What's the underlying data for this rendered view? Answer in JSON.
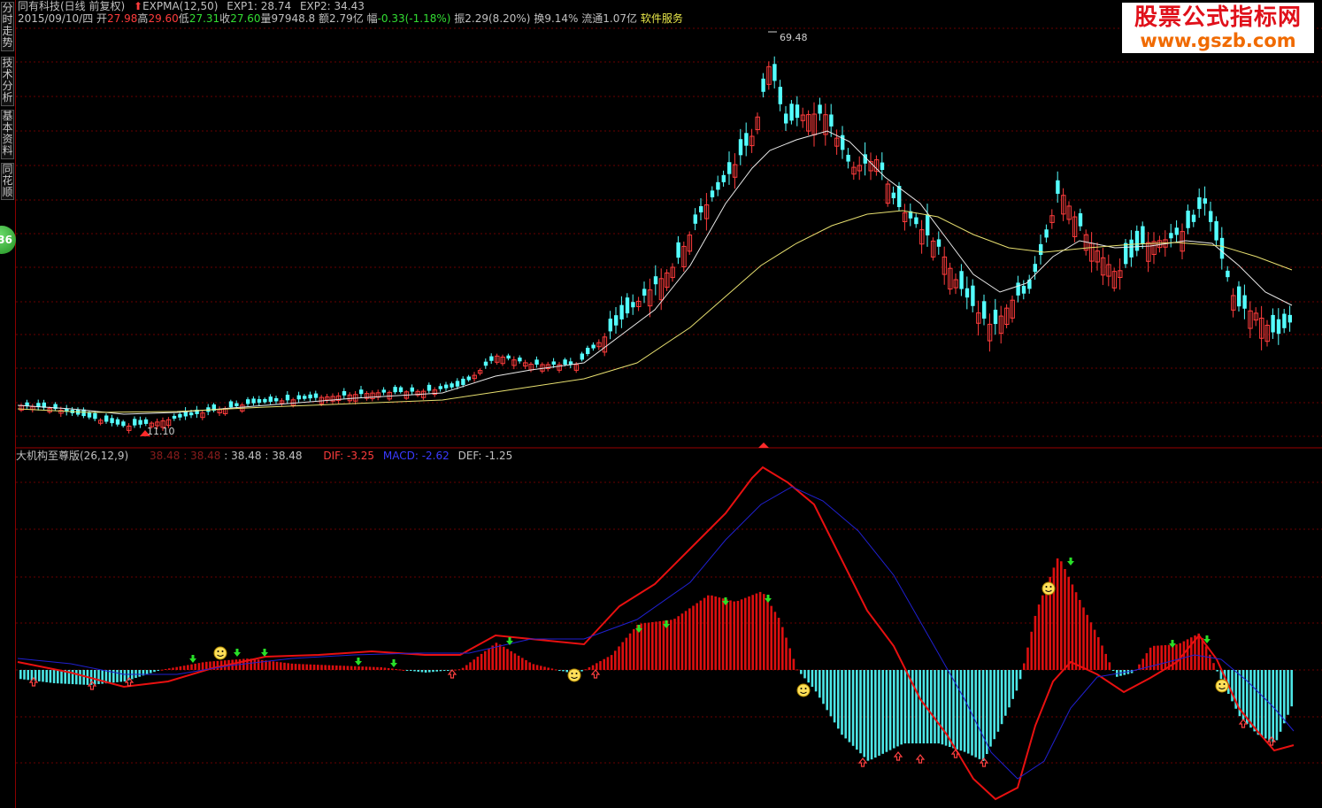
{
  "sidebar": {
    "tabs": [
      "分时走势",
      "技术分析",
      "基本资料",
      "同花顺"
    ],
    "badge": "36"
  },
  "header": {
    "stock": "同有科技(日线 前复权)",
    "indicator": "EXPMA(12,50)",
    "exp1": "EXP1: 28.74",
    "exp2": "EXP2: 34.43",
    "date": "2015/09/10/四",
    "open_label": "开",
    "open": "27.98",
    "high_label": "高",
    "high": "29.60",
    "low_label": "低",
    "low": "27.31",
    "close_label": "收",
    "close": "27.60",
    "volume": "量97948.8",
    "amount": "额2.79亿",
    "change_label": "幅",
    "change": "-0.33(-1.18%)",
    "amplitude": "振2.29(8.20%)",
    "turnover": "换9.14%",
    "float": "流通1.07亿",
    "service": "软件服务"
  },
  "brand": {
    "title": "股票公式指标网",
    "url": "www.gszb.com"
  },
  "price_chart": {
    "high_mark": "69.48",
    "low_mark": "11.10"
  },
  "sub_header": {
    "name": "大机构至尊版(26,12,9)",
    "v1": "38.48",
    "v2": "38.48",
    "v3": "38.48",
    "v4": "38.48",
    "dif": "DIF: -3.25",
    "macd": "MACD: -2.62",
    "def": "DEF: -1.25"
  },
  "colors": {
    "up": "#ff3c3c",
    "down": "#54ffff",
    "dif": "#e81010",
    "macd": "#2020d0",
    "exp1": "#e8e8e8",
    "exp2": "#e8e070",
    "grid": "#6a0000"
  }
}
